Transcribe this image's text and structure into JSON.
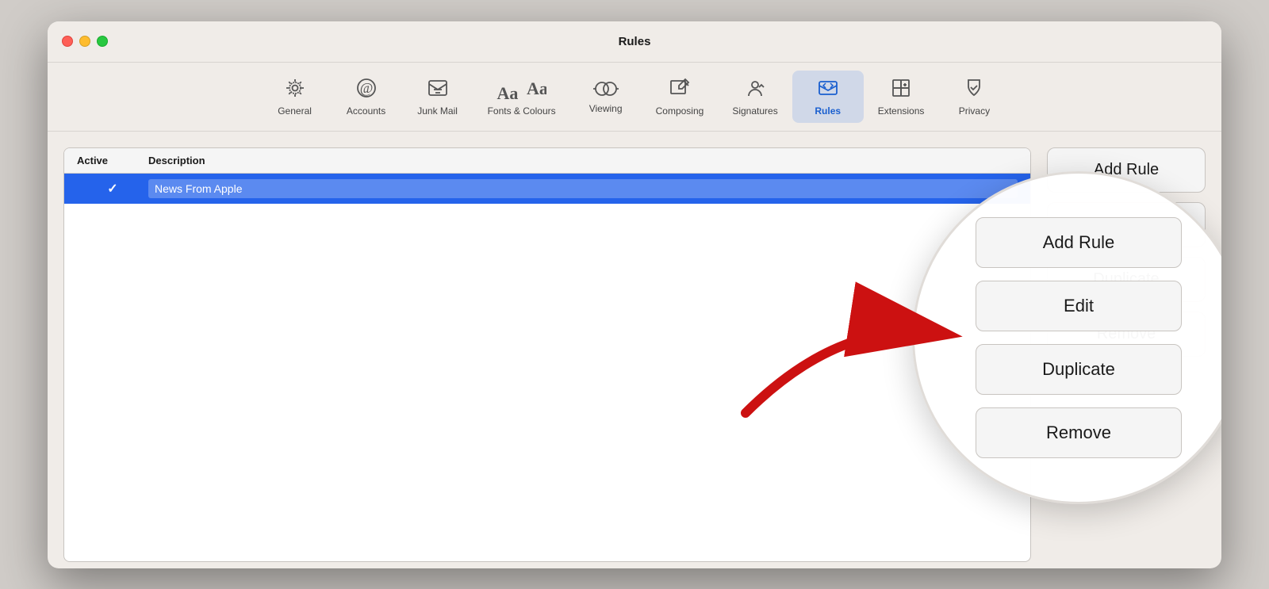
{
  "window": {
    "title": "Rules"
  },
  "toolbar": {
    "items": [
      {
        "id": "general",
        "label": "General",
        "icon": "⚙️"
      },
      {
        "id": "accounts",
        "label": "Accounts",
        "icon": "✉️"
      },
      {
        "id": "junk-mail",
        "label": "Junk Mail",
        "icon": "🗳️"
      },
      {
        "id": "fonts-colours",
        "label": "Fonts & Colours",
        "icon": "Aa"
      },
      {
        "id": "viewing",
        "label": "Viewing",
        "icon": "👓"
      },
      {
        "id": "composing",
        "label": "Composing",
        "icon": "✏️"
      },
      {
        "id": "signatures",
        "label": "Signatures",
        "icon": "🖊️"
      },
      {
        "id": "rules",
        "label": "Rules",
        "icon": "📧",
        "active": true
      },
      {
        "id": "extensions",
        "label": "Extensions",
        "icon": "🧩"
      },
      {
        "id": "privacy",
        "label": "Privacy",
        "icon": "✋"
      }
    ]
  },
  "table": {
    "columns": [
      {
        "id": "active",
        "label": "Active"
      },
      {
        "id": "description",
        "label": "Description"
      }
    ],
    "rows": [
      {
        "active": true,
        "description": "News From Apple",
        "selected": true
      }
    ]
  },
  "sidebar": {
    "add_rule_label": "Add Rule",
    "edit_label": "Edit",
    "duplicate_label": "Duplicate",
    "remove_label": "Remove"
  },
  "zoom_buttons": [
    {
      "id": "add-rule",
      "label": "Add Rule"
    },
    {
      "id": "edit",
      "label": "Edit"
    },
    {
      "id": "duplicate",
      "label": "Duplicate"
    },
    {
      "id": "remove",
      "label": "Remove"
    }
  ],
  "icons": {
    "general": "⚙",
    "accounts": "@",
    "junk_mail": "🗳",
    "fonts_colours": "Aa",
    "viewing": "oo",
    "composing": "✎",
    "signatures": "✍",
    "rules": "✉",
    "extensions": "🧩",
    "privacy": "✋",
    "checkmark": "✓"
  }
}
